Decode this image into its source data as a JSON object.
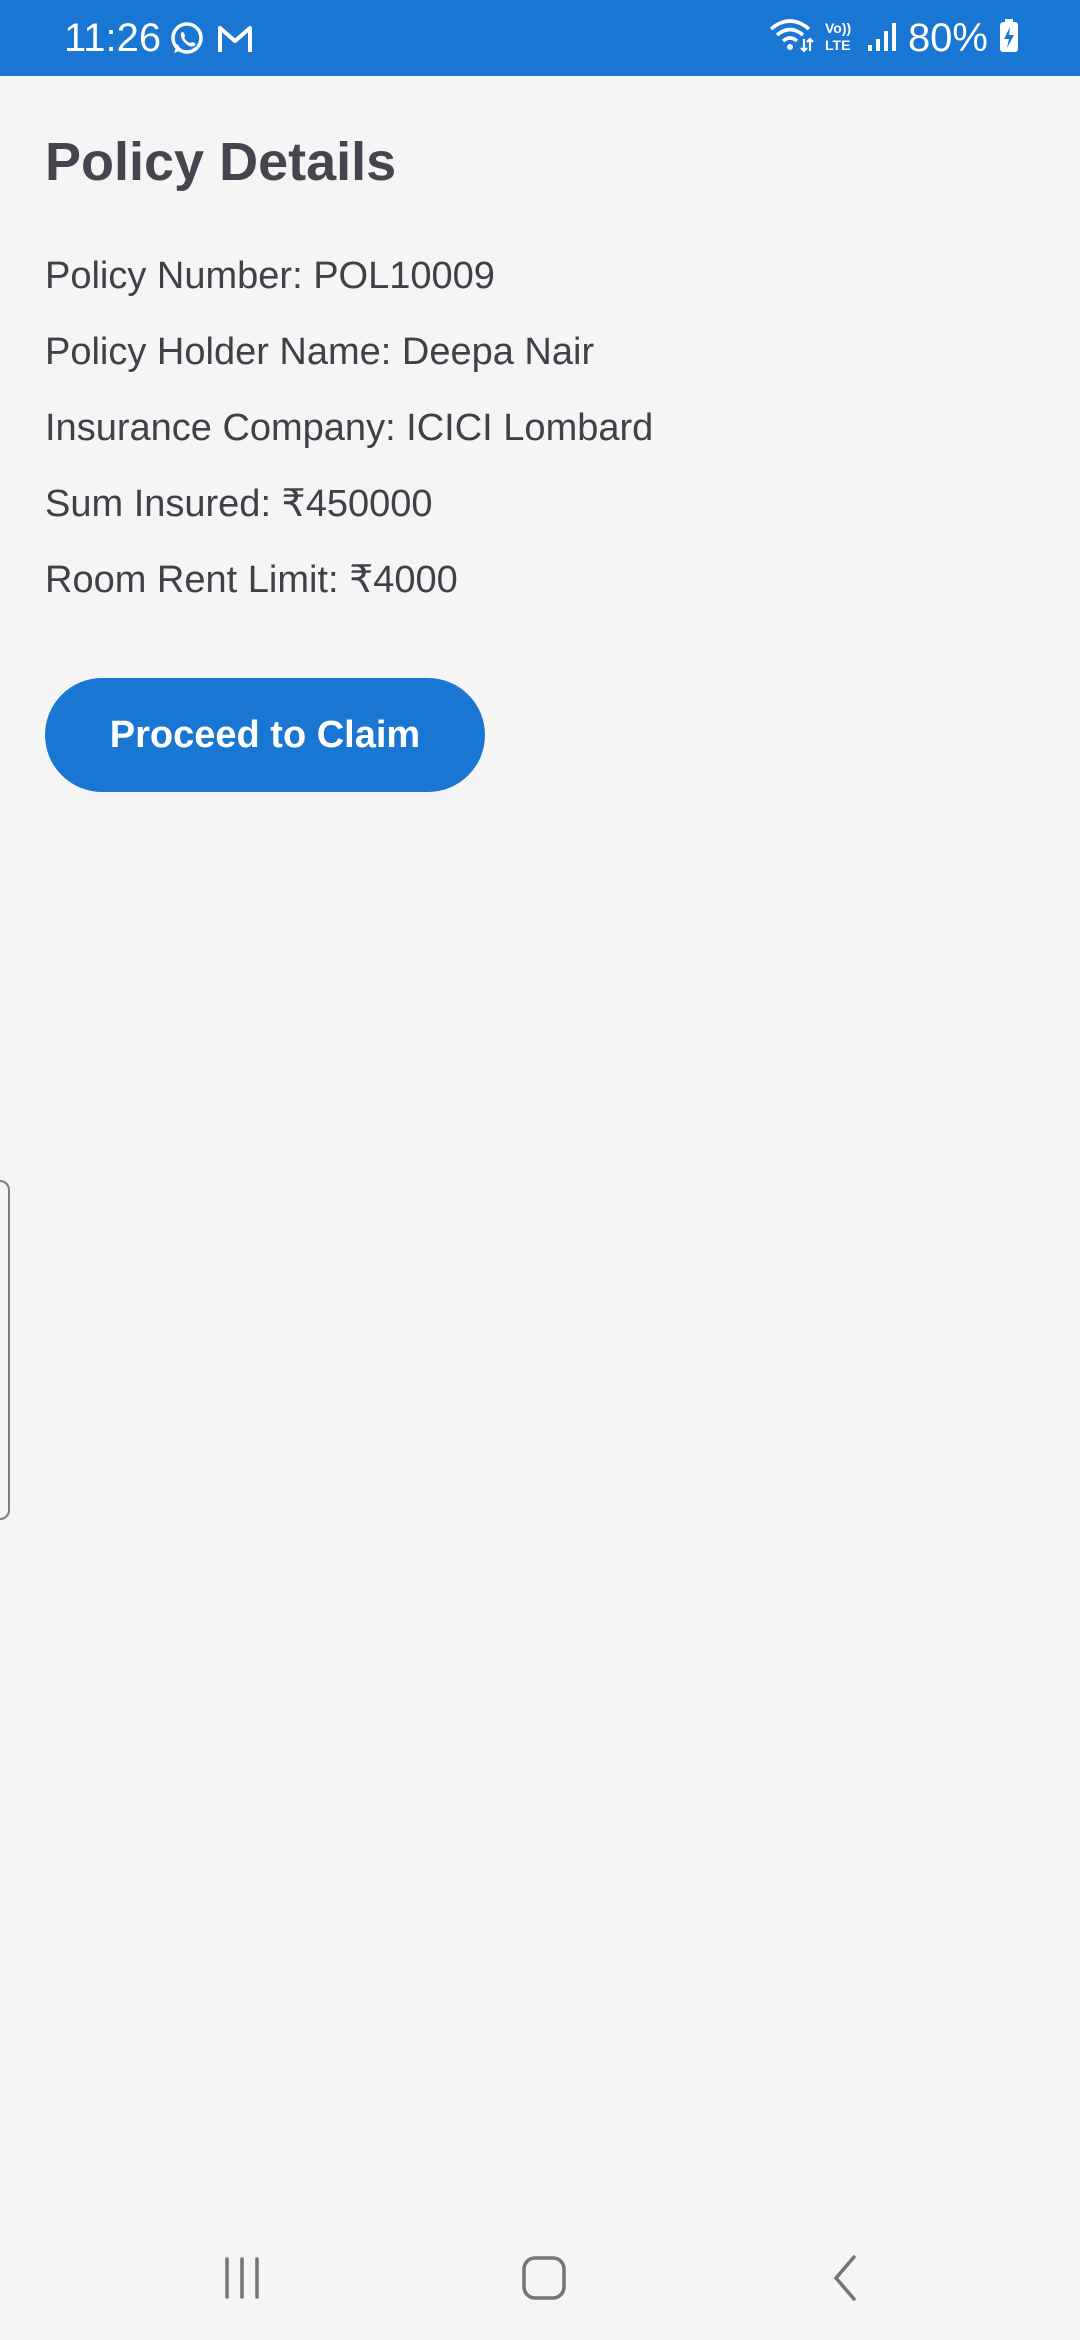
{
  "status_bar": {
    "time": "11:26",
    "battery": "80%",
    "left_icons": [
      "whatsapp-icon",
      "gmail-icon"
    ],
    "right_icons": [
      "wifi-icon",
      "volte-icon",
      "signal-icon",
      "battery-charging-icon"
    ],
    "volte_label_top": "Vo))",
    "volte_label_bottom": "LTE"
  },
  "page": {
    "title": "Policy Details",
    "details": [
      "Policy Number: POL10009",
      "Policy Holder Name: Deepa Nair",
      "Insurance Company: ICICI Lombard",
      "Sum Insured: ₹450000",
      "Room Rent Limit: ₹4000"
    ],
    "claim_button_label": "Proceed to Claim"
  },
  "colors": {
    "accent": "#1976d2",
    "background": "#f5f5f6",
    "title_text": "#46454f",
    "body_text": "#404049"
  },
  "nav_bar": {
    "buttons": [
      "recent-apps-icon",
      "home-icon",
      "back-icon"
    ]
  }
}
